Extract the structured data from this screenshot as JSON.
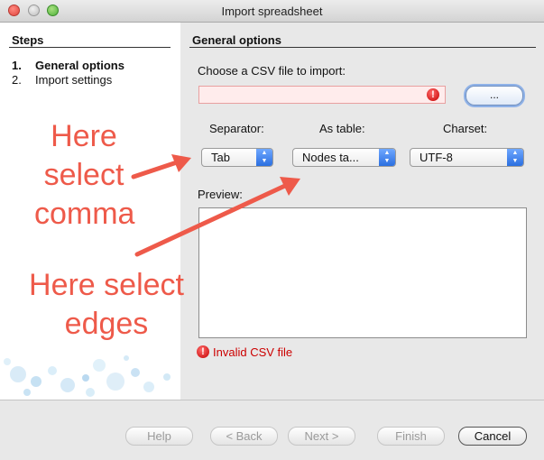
{
  "window": {
    "title": "Import spreadsheet"
  },
  "steps": {
    "title": "Steps",
    "items": [
      {
        "num": "1.",
        "label": "General options"
      },
      {
        "num": "2.",
        "label": "Import settings"
      }
    ]
  },
  "general": {
    "title": "General options",
    "csv_label": "Choose a CSV file to import:",
    "csv_value": "",
    "browse_label": "...",
    "separator": {
      "label": "Separator:",
      "value": "Tab"
    },
    "as_table": {
      "label": "As table:",
      "value": "Nodes ta..."
    },
    "charset": {
      "label": "Charset:",
      "value": "UTF-8"
    },
    "preview_label": "Preview:",
    "error_text": "Invalid CSV file"
  },
  "buttons": {
    "help": "Help",
    "back": "< Back",
    "next": "Next >",
    "finish": "Finish",
    "cancel": "Cancel"
  },
  "annotations": {
    "comma": [
      "Here",
      "select",
      "comma"
    ],
    "edges": [
      "Here select",
      "edges"
    ]
  },
  "colors": {
    "annotation": "#ee5a4a",
    "error": "#cc0000",
    "select_accent": "#2b6fe0"
  }
}
